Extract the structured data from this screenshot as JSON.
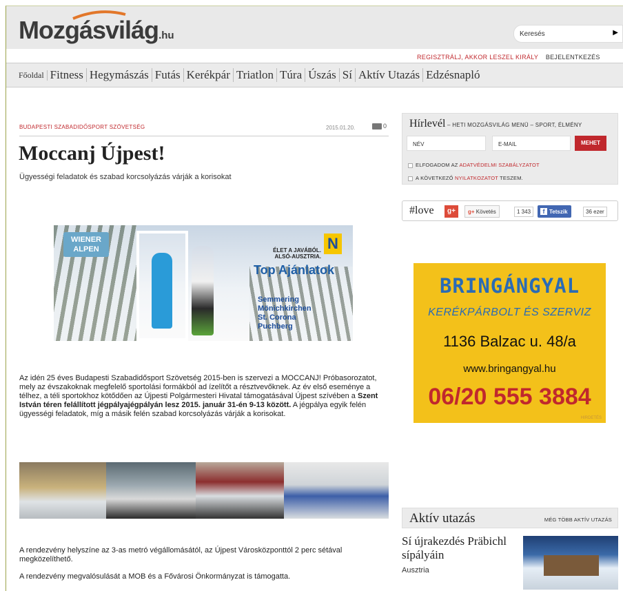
{
  "header": {
    "logo_text": "Mozgásvilág",
    "logo_suffix": ".hu",
    "search_label": "Keresés",
    "register_link": "REGISZTRÁLJ, AKKOR LESZEL KIRÁLY",
    "login_link": "BEJELENTKEZÉS"
  },
  "nav": {
    "items": [
      "Főoldal",
      "Fitness",
      "Hegymászás",
      "Futás",
      "Kerékpár",
      "Triatlon",
      "Túra",
      "Úszás",
      "Sí",
      "Aktív Utazás",
      "Edzésnapló"
    ]
  },
  "article": {
    "category": "BUDAPESTI SZABADIDŐSPORT SZÖVETSÉG",
    "date": "2015.01.20.",
    "comment_count": "0",
    "title": "Moccanj Újpest!",
    "lead": "Ügyességi feladatok és szabad korcsolyázás várják a korisokat",
    "banner": {
      "logo": "WIENER ALPEN",
      "claim": "ÉLET A JAVÁBÓL. ALSÓ-AUSZTRIA.",
      "badge": "N",
      "headline": "Top Ajánlatok",
      "places": [
        "Semmering",
        "Mönichkirchen",
        "St. Corona",
        "Puchberg"
      ]
    },
    "para1_a": "Az idén 25 éves Budapesti Szabadidősport Szövetség 2015-ben is szervezi a MOCCANJ! Próbasorozatot, mely az évszakoknak megfelelő sportolási formákból ad ízelítőt a résztvevőknek. Az év első eseménye a télhez, a téli sportokhoz kötődően az Újpesti Polgármesteri Hivatal támogatásával Újpest szívében a ",
    "para1_bold": "Szent István téren felállított jégpályajégpályán lesz 2015. január 31-én 9-13 között.",
    "para1_b": " A jégpálya egyik felén ügyességi feladatok, míg a másik felén szabad korcsolyázás várják a korisokat.",
    "para2": "A rendezvény helyszíne az 3-as metró végállomásától, az Újpest Városközponttól 2 perc sétával megközelíthető.",
    "para3": "A rendezvény megvalósulását a MOB és a Fővárosi Önkormányzat is támogatta."
  },
  "newsletter": {
    "title": "Hírlevél",
    "subtitle": " – HETI MOZGÁSVILÁG MENÜ – SPORT, ÉLMÉNY",
    "name_placeholder": "NÉV",
    "email_placeholder": "E-MAIL",
    "send_label": "MEHET",
    "consent1_pre": "ELFOGADOM AZ ",
    "consent1_link": "ADATVÉDELMI SZABÁLYZATOT",
    "consent2_pre": "A KÖVETKEZŐ ",
    "consent2_link": "NYILATKOZATOT",
    "consent2_post": " TESZEM."
  },
  "social": {
    "title": "#love",
    "gplus_label": "g+",
    "follow_label": "Követés",
    "follow_count": "1 343",
    "fb_label": "Tetszik",
    "fb_count": "36 ezer"
  },
  "ad": {
    "name": "BRINGÁNGYAL",
    "subtitle": "KERÉKPÁRBOLT ÉS SZERVIZ",
    "address": "1136 Balzac u. 48/a",
    "url": "www.bringangyal.hu",
    "phone": "06/20 555 3884",
    "tag": "HIRDETÉS"
  },
  "aktiv": {
    "title": "Aktív utazás",
    "more_link": "MÉG TÖBB AKTÍV UTAZÁS",
    "article_title": "Sí újrakezdés Präbichl sípályáin",
    "article_location": "Ausztria"
  },
  "colors": {
    "accent_red": "#c0282d",
    "ad_yellow": "#f3c11a",
    "ad_blue": "#2a6bb5",
    "facebook": "#4267b2",
    "gplus": "#dd4b39"
  }
}
